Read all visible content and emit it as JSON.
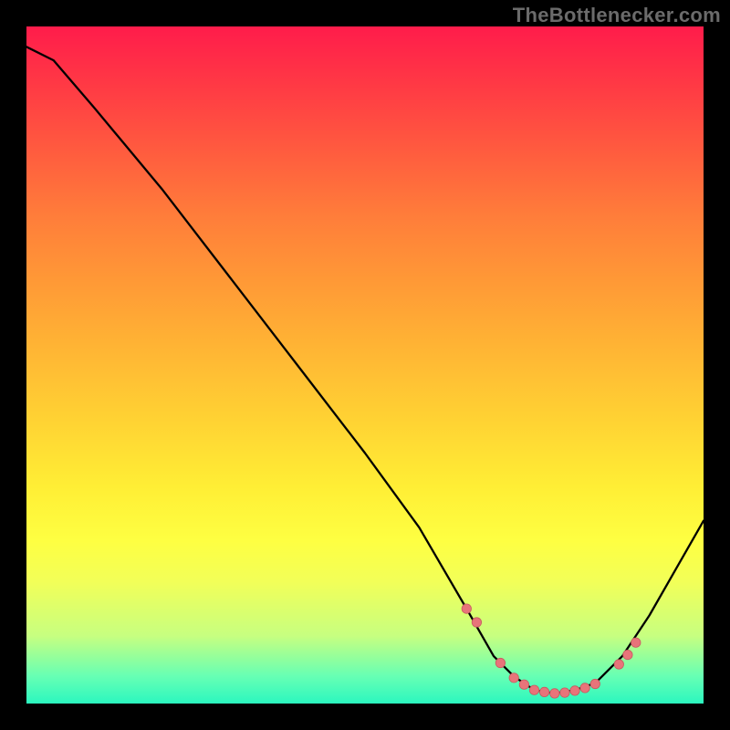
{
  "attribution": "TheBottlenecker.com",
  "chart_data": {
    "type": "line",
    "title": "",
    "xlabel": "",
    "ylabel": "",
    "xlim": [
      0,
      100
    ],
    "ylim": [
      0,
      100
    ],
    "x": [
      0,
      4,
      10,
      20,
      30,
      40,
      50,
      58,
      65,
      69,
      72,
      75,
      78,
      81,
      84,
      88,
      92,
      96,
      100
    ],
    "values": [
      97,
      95,
      88,
      76,
      63,
      50,
      37,
      26,
      14,
      7,
      4,
      2,
      1.5,
      2,
      3,
      7,
      13,
      20,
      27
    ],
    "markers_x": [
      65,
      66.5,
      70,
      72,
      73.5,
      75,
      76.5,
      78,
      79.5,
      81,
      82.5,
      84,
      87.5,
      88.8,
      90
    ],
    "markers_y": [
      14,
      12,
      6,
      3.8,
      2.8,
      2,
      1.7,
      1.5,
      1.6,
      1.9,
      2.3,
      2.9,
      5.8,
      7.2,
      9
    ]
  },
  "colors": {
    "curve": "#000000",
    "marker_fill": "#e8747a"
  }
}
